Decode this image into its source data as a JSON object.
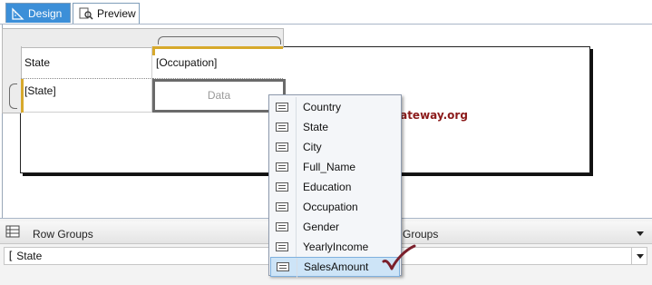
{
  "tabs": [
    {
      "label": "Design",
      "active": true,
      "icon": "design-ruler-icon"
    },
    {
      "label": "Preview",
      "active": false,
      "icon": "preview-icon"
    }
  ],
  "tablix": {
    "header_row": {
      "col1": "State",
      "col2": "[Occupation]"
    },
    "group_row": {
      "col1": "[State]",
      "col2": "Data"
    }
  },
  "watermark": "©tutorialgateway.org",
  "field_list": {
    "items": [
      "Country",
      "State",
      "City",
      "Full_Name",
      "Education",
      "Occupation",
      "Gender",
      "YearlyIncome",
      "SalesAmount"
    ],
    "selected": "SalesAmount"
  },
  "grouping_pane": {
    "row_groups_label": "Row Groups",
    "column_groups_label": "Groups",
    "row_group_items": [
      {
        "bracket": "[",
        "name": "State"
      }
    ]
  },
  "colors": {
    "accent_tab": "#3c8fd8",
    "selection_bar": "#d7a92c",
    "watermark": "#8b1a1a",
    "checkmark": "#7a1f2b",
    "list_highlight": "#cde4f7"
  }
}
